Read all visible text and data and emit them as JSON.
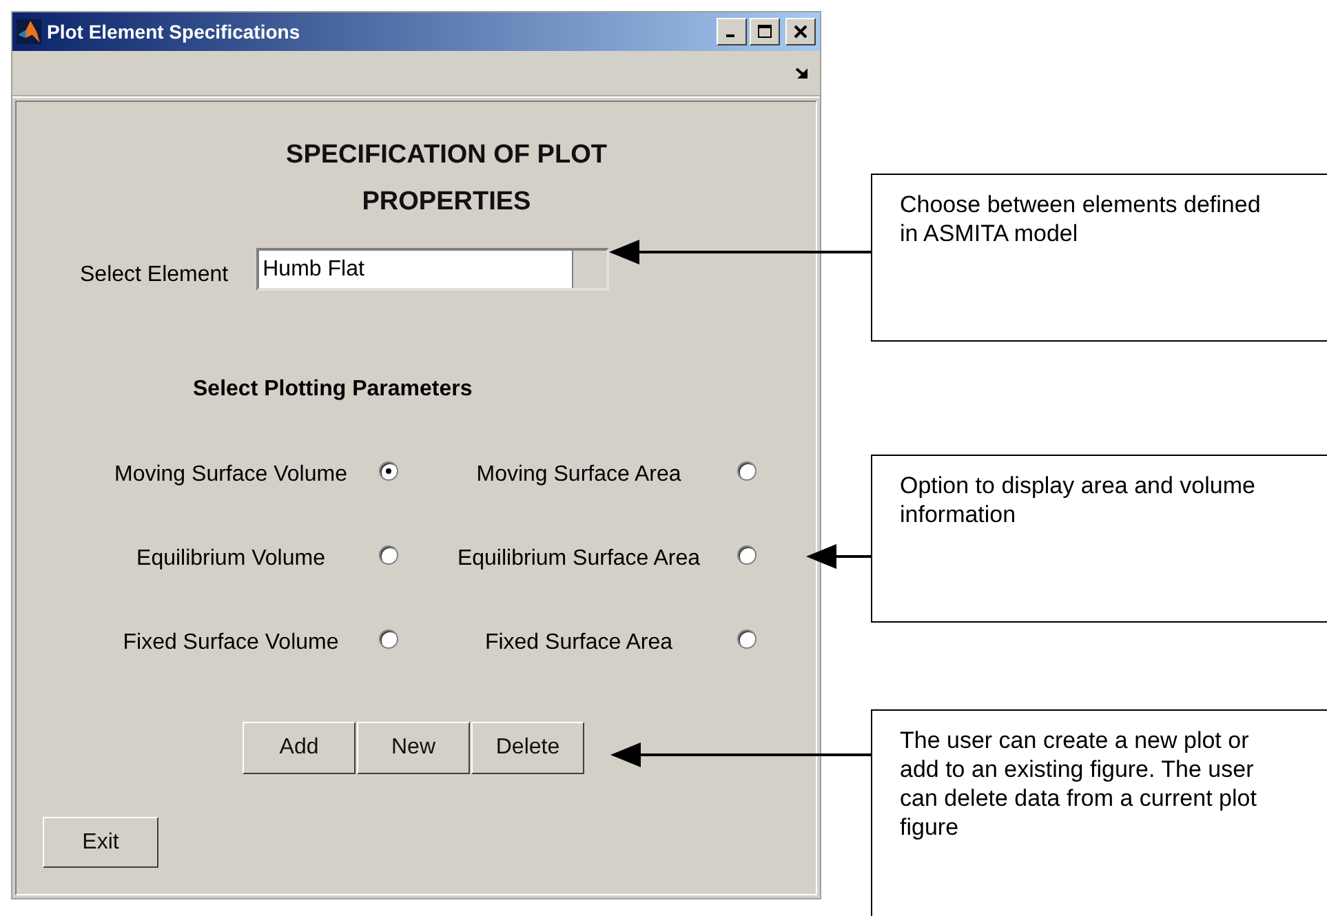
{
  "window": {
    "title": "Plot Element Specifications"
  },
  "heading": "SPECIFICATION OF PLOT PROPERTIES",
  "element_select": {
    "label": "Select Element",
    "value": "Humb Flat"
  },
  "parameters_heading": "Select Plotting Parameters",
  "parameters": [
    {
      "label": "Moving Surface Volume",
      "selected": true
    },
    {
      "label": "Moving Surface Area",
      "selected": false
    },
    {
      "label": "Equilibrium Volume",
      "selected": false
    },
    {
      "label": "Equilibrium Surface Area",
      "selected": false
    },
    {
      "label": "Fixed Surface Volume",
      "selected": false
    },
    {
      "label": "Fixed Surface Area",
      "selected": false
    }
  ],
  "buttons": [
    "Add",
    "New",
    "Delete"
  ],
  "exit_button": "Exit",
  "callouts": [
    {
      "text": "Choose between elements defined in ASMITA model"
    },
    {
      "text": "Option to display area and volume information"
    },
    {
      "text": "The user can create a new plot or add to an existing figure. The user can delete data from a current plot figure"
    }
  ]
}
